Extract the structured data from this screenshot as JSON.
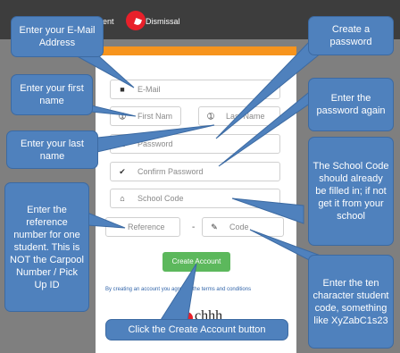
{
  "brand": {
    "part1": "Silent",
    "part2": "Dismissal"
  },
  "form": {
    "email_placeholder": "E-Mail",
    "first_name_placeholder": "First Nam",
    "last_name_placeholder": "Last Name",
    "password_placeholder": "Password",
    "confirm_password_placeholder": "Confirm Password",
    "school_code_placeholder": "School Code",
    "reference_placeholder": "Reference",
    "separator": "-",
    "code_placeholder": "Code",
    "create_button": "Create Account",
    "terms_text": "By creating an account you agree to the terms and conditions",
    "captcha_text": "chhh"
  },
  "callouts": {
    "email": "Enter your E-Mail Address",
    "first_name": "Enter your first name",
    "last_name": "Enter your last name",
    "reference": "Enter the reference number for one student. This is NOT the Carpool Number / Pick Up ID",
    "password": "Create a password",
    "password_again": "Enter the password again",
    "school_code": "The School Code should already be filled in; if not get it from your school",
    "code": "Enter the ten character student code, something like XyZabC1s23",
    "create_button": "Click the Create Account button"
  },
  "colors": {
    "callout": "#4f81bd",
    "accent": "#f7941d",
    "button": "#5cb85c",
    "logo": "#e8202a"
  }
}
